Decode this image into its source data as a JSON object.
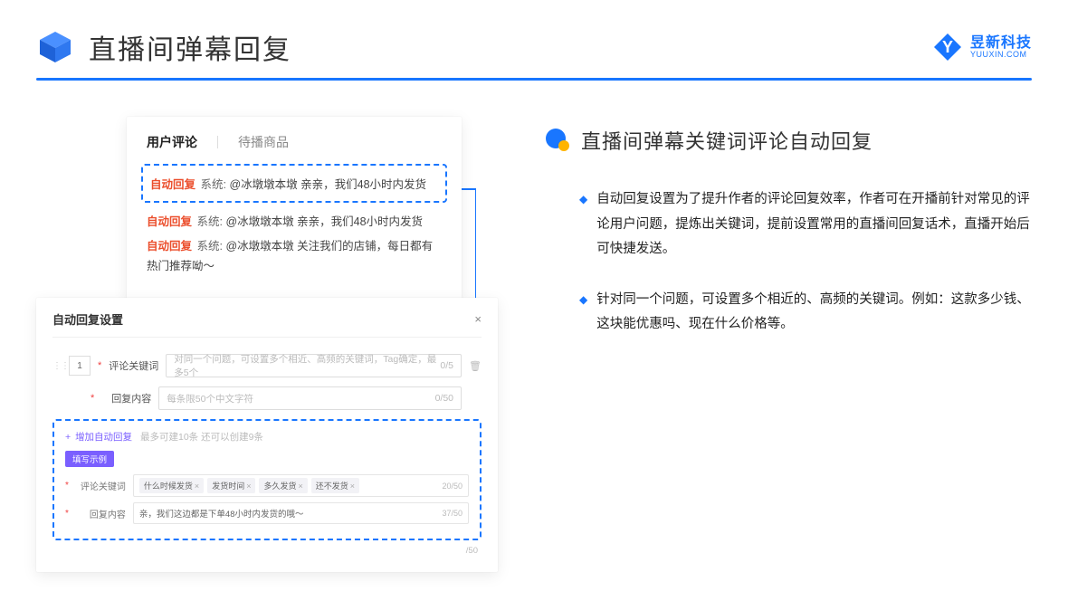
{
  "header": {
    "title": "直播间弹幕回复"
  },
  "brand": {
    "cn": "昱新科技",
    "en": "YUUXIN.COM"
  },
  "section": {
    "title": "直播间弹幕关键词评论自动回复",
    "bullets": [
      "自动回复设置为了提升作者的评论回复效率，作者可在开播前针对常见的评论用户问题，提炼出关键词，提前设置常用的直播间回复话术，直播开始后可快捷发送。",
      "针对同一个问题，可设置多个相近的、高频的关键词。例如：这款多少钱、这块能优惠吗、现在什么价格等。"
    ]
  },
  "cardTop": {
    "tabActive": "用户评论",
    "tabInactive": "待播商品",
    "highlight": {
      "tag": "自动回复",
      "sys": "系统:",
      "text": "@冰墩墩本墩 亲亲，我们48小时内发货"
    },
    "lines": [
      {
        "tag": "自动回复",
        "sys": "系统:",
        "text": "@冰墩墩本墩 亲亲，我们48小时内发货"
      },
      {
        "tag": "自动回复",
        "sys": "系统:",
        "text": "@冰墩墩本墩 关注我们的店铺，每日都有热门推荐呦～"
      }
    ]
  },
  "cardBottom": {
    "title": "自动回复设置",
    "num": "1",
    "rowKeyword": {
      "label": "评论关键词",
      "placeholder": "对同一个问题，可设置多个相近、高频的关键词，Tag确定，最多5个",
      "count": "0/5"
    },
    "rowContent": {
      "label": "回复内容",
      "placeholder": "每条限50个中文字符",
      "count": "0/50"
    },
    "addLine": {
      "link": "增加自动回复",
      "note": "最多可建10条 还可以创建9条"
    },
    "exampleBadge": "填写示例",
    "exKeyword": {
      "label": "评论关键词",
      "tags": [
        "什么时候发货",
        "发货时间",
        "多久发货",
        "还不发货"
      ],
      "count": "20/50"
    },
    "exContent": {
      "label": "回复内容",
      "text": "亲，我们这边都是下单48小时内发货的哦～",
      "count": "37/50"
    },
    "outsideCount": "/50"
  }
}
